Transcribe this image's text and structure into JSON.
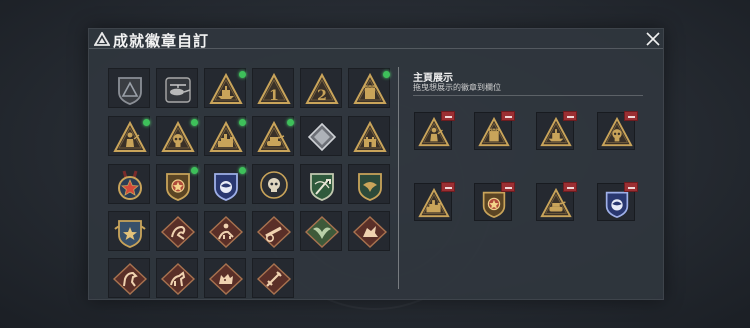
{
  "window": {
    "title": "成就徽章自訂",
    "close_icon": "close-icon"
  },
  "collection": {
    "badges": [
      {
        "icon": "gray-triangle-shield-badge",
        "new": false
      },
      {
        "icon": "helicopter-badge",
        "new": false
      },
      {
        "icon": "ship-triangle-badge",
        "new": true
      },
      {
        "icon": "number-1-triangle-badge",
        "new": false
      },
      {
        "icon": "number-2-triangle-badge",
        "new": false
      },
      {
        "icon": "fortress-triangle-badge",
        "new": true
      },
      {
        "icon": "soldier-triangle-badge",
        "new": true
      },
      {
        "icon": "skull-triangle-badge",
        "new": true
      },
      {
        "icon": "city-triangle-badge",
        "new": true
      },
      {
        "icon": "tank-triangle-badge",
        "new": true
      },
      {
        "icon": "silver-diamond-badge",
        "new": false
      },
      {
        "icon": "castle-triangle-badge",
        "new": false
      },
      {
        "icon": "star-medal-badge",
        "new": false
      },
      {
        "icon": "gold-star-shield-badge",
        "new": true
      },
      {
        "icon": "blue-eagle-shield-badge",
        "new": true
      },
      {
        "icon": "skull-circle-badge",
        "new": false
      },
      {
        "icon": "green-sword-badge",
        "new": false
      },
      {
        "icon": "green-eagle-shield-badge",
        "new": false
      },
      {
        "icon": "winged-star-shield-badge",
        "new": false
      },
      {
        "icon": "dragon-diamond-badge",
        "new": false
      },
      {
        "icon": "rider-diamond-badge",
        "new": false
      },
      {
        "icon": "cannon-diamond-badge",
        "new": false
      },
      {
        "icon": "green-wings-diamond-badge",
        "new": false
      },
      {
        "icon": "dragon-head-diamond-badge",
        "new": false
      },
      {
        "icon": "horse-diamond-badge",
        "new": false
      },
      {
        "icon": "war-horse-diamond-badge",
        "new": false
      },
      {
        "icon": "wolf-diamond-badge",
        "new": false
      },
      {
        "icon": "sword-diamond-badge",
        "new": false
      }
    ]
  },
  "display": {
    "title": "主頁展示",
    "subtitle": "拖曳想展示的徽章到欄位",
    "slots": [
      {
        "icon": "soldier-triangle-badge"
      },
      {
        "icon": "fortress-triangle-badge"
      },
      {
        "icon": "ship-triangle-badge"
      },
      {
        "icon": "skull-triangle-badge"
      },
      {
        "icon": "city-triangle-badge"
      },
      {
        "icon": "gold-star-shield-badge"
      },
      {
        "icon": "tank-triangle-badge"
      },
      {
        "icon": "blue-eagle-shield-badge"
      }
    ]
  },
  "colors": {
    "gold": "#c9a45a",
    "bronze_bg": "#5a2f28",
    "new_dot": "#3ec05a",
    "remove": "#9b2f33"
  }
}
